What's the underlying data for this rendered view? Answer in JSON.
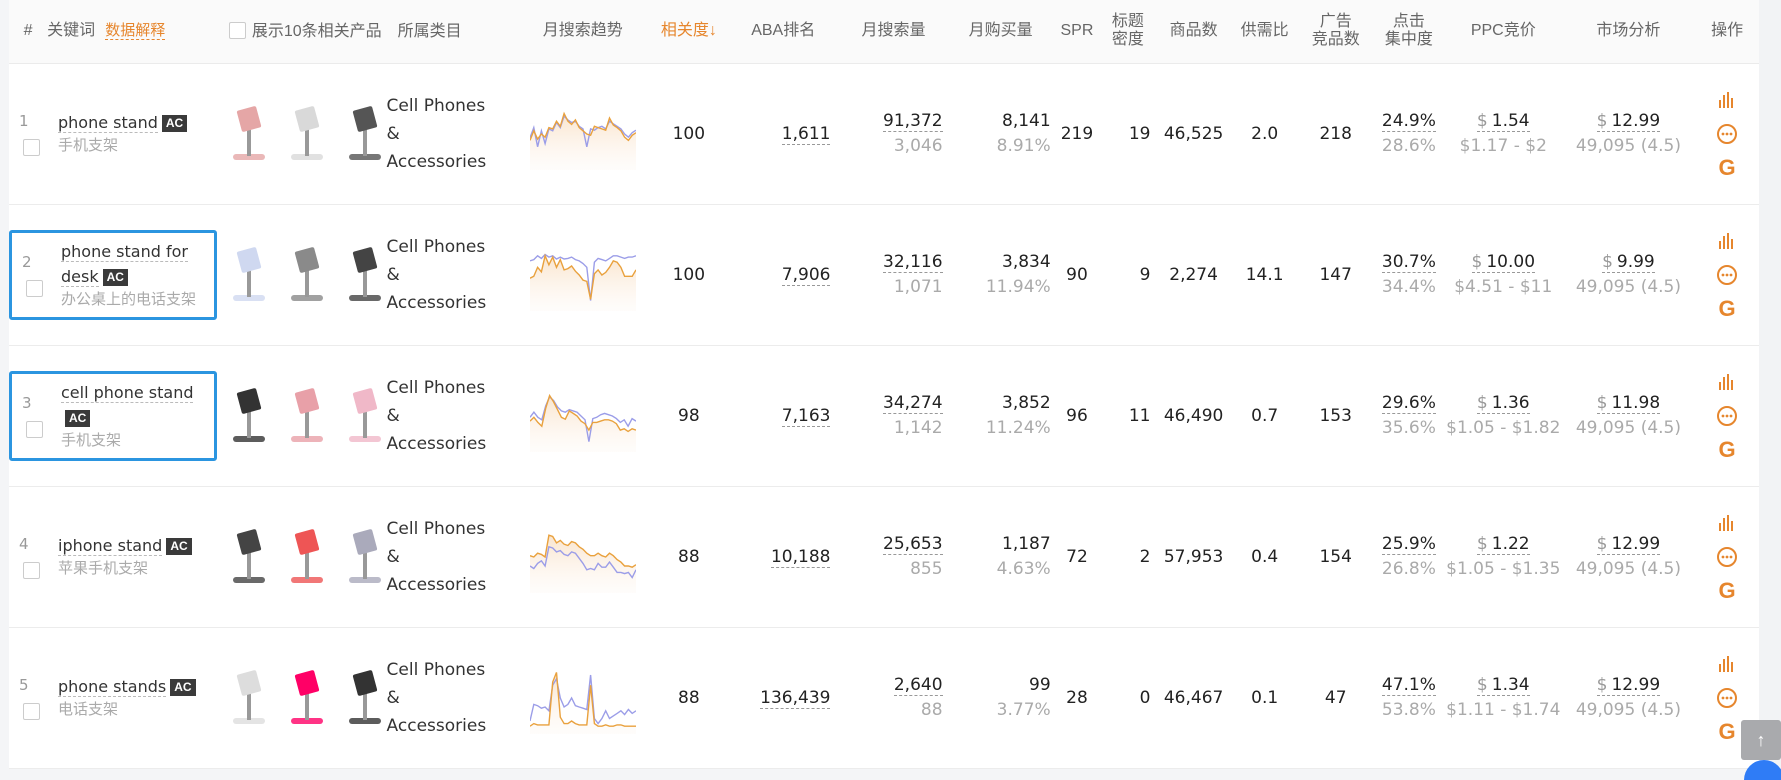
{
  "header": {
    "index": "#",
    "keyword": "关键词",
    "explain_link": "数据解释",
    "show_products_label": "展示10条相关产品",
    "category": "所属类目",
    "trend": "月搜索趋势",
    "relevance": "相关度↓",
    "aba_rank": "ABA排名",
    "monthly_search": "月搜索量",
    "monthly_purchase": "月购买量",
    "spr": "SPR",
    "title_density_1": "标题",
    "title_density_2": "密度",
    "product_count": "商品数",
    "supply_demand": "供需比",
    "ad_products_1": "广告",
    "ad_products_2": "竞品数",
    "click_conc_1": "点击",
    "click_conc_2": "集中度",
    "ppc": "PPC竞价",
    "market": "市场分析",
    "actions": "操作"
  },
  "colors": {
    "accent": "#e6862d",
    "highlight": "#2b95e0",
    "trend_orange": "#e9a13d",
    "trend_purple": "#9b9de8"
  },
  "rows": [
    {
      "index": "1",
      "keyword": "phone stand",
      "badge": "AC",
      "cn": "手机支架",
      "highlighted": false,
      "category": [
        "Cell Phones",
        "&",
        "Accessories"
      ],
      "relevance": "100",
      "aba": "1,611",
      "search": "91,372",
      "search_sub": "3,046",
      "purchase": "8,141",
      "purchase_sub": "8.91%",
      "spr": "219",
      "title_density": "19",
      "products": "46,525",
      "supply_demand": "2.0",
      "ad_products": "218",
      "click": "24.9%",
      "click_sub": "28.6%",
      "ppc_symbol": "$",
      "ppc": "1.54",
      "ppc_range": "$1.17 - $2",
      "market_symbol": "$",
      "market_price": "12.99",
      "market_sub": "49,095 (4.5)",
      "trend_orange": [
        40,
        55,
        42,
        50,
        45,
        60,
        58,
        70,
        62,
        82,
        70,
        65,
        72,
        60,
        55,
        50,
        48,
        62,
        60,
        58,
        56,
        75,
        64,
        60,
        55,
        45,
        40,
        48,
        52
      ],
      "trend_purple": [
        44,
        60,
        30,
        55,
        35,
        58,
        55,
        68,
        60,
        78,
        72,
        68,
        70,
        62,
        58,
        30,
        58,
        56,
        60,
        62,
        58,
        70,
        66,
        62,
        58,
        50,
        45,
        52,
        56
      ]
    },
    {
      "index": "2",
      "keyword": "phone stand for desk",
      "badge": "AC",
      "cn": "办公桌上的电话支架",
      "highlighted": true,
      "category": [
        "Cell Phones",
        "&",
        "Accessories"
      ],
      "relevance": "100",
      "aba": "7,906",
      "search": "32,116",
      "search_sub": "1,071",
      "purchase": "3,834",
      "purchase_sub": "11.94%",
      "spr": "90",
      "title_density": "9",
      "products": "2,274",
      "supply_demand": "14.1",
      "ad_products": "147",
      "click": "30.7%",
      "click_sub": "34.4%",
      "ppc_symbol": "$",
      "ppc": "10.00",
      "ppc_range": "$4.51 - $11",
      "market_symbol": "$",
      "market_price": "9.99",
      "market_sub": "49,095 (4.5)",
      "trend_orange": [
        45,
        48,
        62,
        55,
        80,
        66,
        78,
        62,
        74,
        58,
        60,
        64,
        56,
        50,
        42,
        40,
        12,
        52,
        58,
        50,
        54,
        62,
        72,
        70,
        62,
        48,
        48,
        48,
        58
      ],
      "trend_purple": [
        72,
        74,
        80,
        76,
        82,
        78,
        80,
        75,
        78,
        75,
        76,
        78,
        74,
        72,
        68,
        62,
        10,
        70,
        76,
        74,
        72,
        76,
        80,
        80,
        78,
        76,
        78,
        78,
        80
      ]
    },
    {
      "index": "3",
      "keyword": "cell phone stand",
      "badge": "AC",
      "cn": "手机支架",
      "highlighted": true,
      "category": [
        "Cell Phones",
        "&",
        "Accessories"
      ],
      "relevance": "98",
      "aba": "7,163",
      "search": "34,274",
      "search_sub": "1,142",
      "purchase": "3,852",
      "purchase_sub": "11.24%",
      "spr": "96",
      "title_density": "11",
      "products": "46,490",
      "supply_demand": "0.7",
      "ad_products": "153",
      "click": "29.6%",
      "click_sub": "35.6%",
      "ppc_symbol": "$",
      "ppc": "1.36",
      "ppc_range": "$1.05 - $1.82",
      "market_symbol": "$",
      "market_price": "11.98",
      "market_sub": "49,095 (4.5)",
      "trend_orange": [
        42,
        48,
        40,
        34,
        62,
        82,
        72,
        60,
        48,
        45,
        58,
        54,
        50,
        42,
        38,
        28,
        40,
        40,
        42,
        44,
        44,
        42,
        38,
        28,
        30,
        26,
        30,
        28
      ],
      "trend_purple": [
        48,
        56,
        48,
        44,
        66,
        80,
        74,
        64,
        58,
        56,
        60,
        58,
        56,
        50,
        44,
        10,
        46,
        48,
        52,
        54,
        52,
        50,
        46,
        40,
        44,
        34,
        46,
        42
      ]
    },
    {
      "index": "4",
      "keyword": "iphone stand",
      "badge": "AC",
      "cn": "苹果手机支架",
      "highlighted": false,
      "category": [
        "Cell Phones",
        "&",
        "Accessories"
      ],
      "relevance": "88",
      "aba": "10,188",
      "search": "25,653",
      "search_sub": "855",
      "purchase": "1,187",
      "purchase_sub": "4.63%",
      "spr": "72",
      "title_density": "2",
      "products": "57,953",
      "supply_demand": "0.4",
      "ad_products": "154",
      "click": "25.9%",
      "click_sub": "26.8%",
      "ppc_symbol": "$",
      "ppc": "1.22",
      "ppc_range": "$1.05 - $1.35",
      "market_symbol": "$",
      "market_price": "12.99",
      "market_sub": "49,095 (4.5)",
      "trend_orange": [
        52,
        50,
        56,
        54,
        50,
        84,
        82,
        72,
        76,
        70,
        68,
        74,
        72,
        66,
        62,
        56,
        52,
        52,
        56,
        52,
        50,
        56,
        52,
        46,
        42,
        36,
        36,
        34,
        38
      ],
      "trend_purple": [
        36,
        32,
        40,
        44,
        36,
        66,
        64,
        58,
        60,
        54,
        52,
        58,
        56,
        48,
        40,
        30,
        32,
        30,
        40,
        34,
        34,
        42,
        34,
        26,
        26,
        24,
        26,
        18,
        30
      ]
    },
    {
      "index": "5",
      "keyword": "phone stands",
      "badge": "AC",
      "cn": "电话支架",
      "highlighted": false,
      "category": [
        "Cell Phones",
        "&",
        "Accessories"
      ],
      "relevance": "88",
      "aba": "136,439",
      "search": "2,640",
      "search_sub": "88",
      "purchase": "99",
      "purchase_sub": "3.77%",
      "spr": "28",
      "title_density": "0",
      "products": "46,467",
      "supply_demand": "0.1",
      "ad_products": "47",
      "click": "47.1%",
      "click_sub": "53.8%",
      "ppc_symbol": "$",
      "ppc": "1.34",
      "ppc_range": "$1.11 - $1.74",
      "market_symbol": "$",
      "market_price": "12.99",
      "market_sub": "49,095 (4.5)",
      "trend_orange": [
        6,
        10,
        8,
        8,
        8,
        8,
        75,
        90,
        20,
        10,
        10,
        14,
        10,
        8,
        8,
        8,
        70,
        10,
        6,
        6,
        8,
        6,
        6,
        8,
        8,
        6,
        6,
        6,
        6
      ],
      "trend_purple": [
        14,
        40,
        38,
        34,
        36,
        30,
        70,
        80,
        50,
        36,
        40,
        50,
        38,
        36,
        34,
        32,
        86,
        18,
        10,
        18,
        30,
        18,
        22,
        26,
        30,
        24,
        32,
        26,
        30
      ]
    }
  ],
  "scroll_top_label": "↑"
}
